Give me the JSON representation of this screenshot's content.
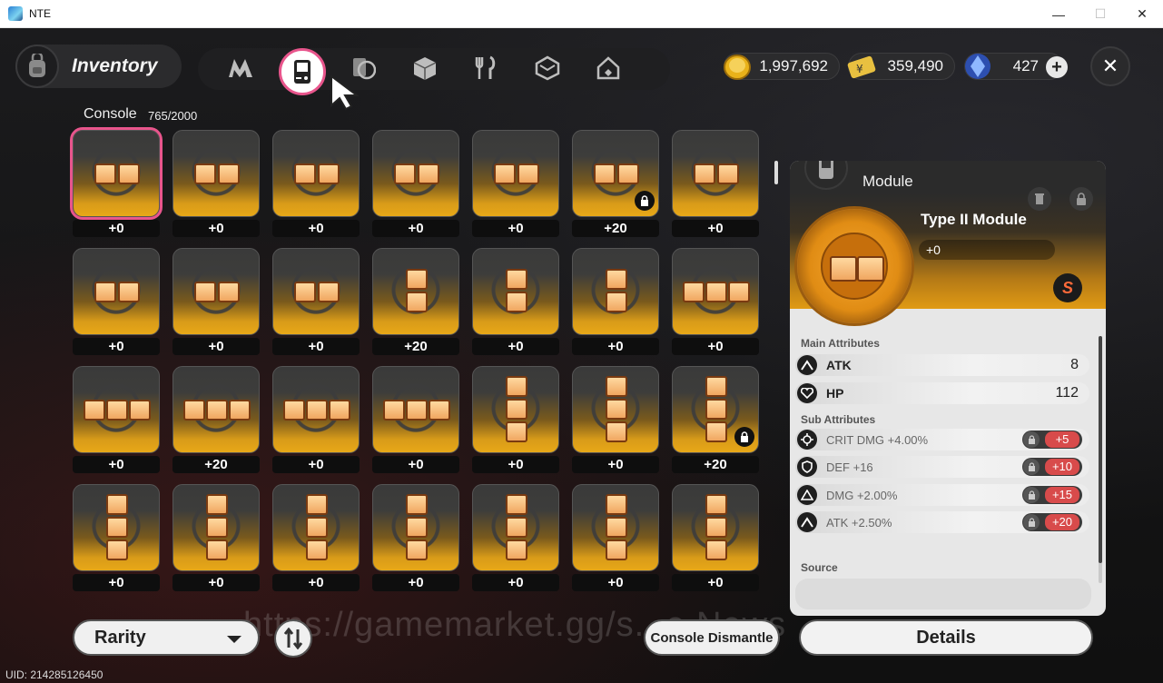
{
  "window": {
    "title": "NTE",
    "minimize": "—",
    "maximize": "☐",
    "close": "✕"
  },
  "header": {
    "title": "Inventory",
    "tabs": [
      "n-logo",
      "console",
      "cards",
      "box",
      "food",
      "cube",
      "home"
    ],
    "currencies": [
      {
        "icon": "gold-coin-icon",
        "value": "1,997,692"
      },
      {
        "icon": "ticket-icon",
        "value": "359,490"
      },
      {
        "icon": "crystal-icon",
        "value": "427"
      }
    ],
    "plus": "+",
    "close": "✕"
  },
  "category": {
    "label": "Console",
    "count": "765/2000"
  },
  "grid": [
    [
      {
        "level": "+0",
        "shape": "h2",
        "selected": true
      },
      {
        "level": "+0",
        "shape": "h2"
      },
      {
        "level": "+0",
        "shape": "h2"
      },
      {
        "level": "+0",
        "shape": "h2"
      },
      {
        "level": "+0",
        "shape": "h2"
      },
      {
        "level": "+20",
        "shape": "h2",
        "locked": true
      },
      {
        "level": "+0",
        "shape": "h2"
      }
    ],
    [
      {
        "level": "+0",
        "shape": "h2"
      },
      {
        "level": "+0",
        "shape": "h2"
      },
      {
        "level": "+0",
        "shape": "h2"
      },
      {
        "level": "+20",
        "shape": "v2"
      },
      {
        "level": "+0",
        "shape": "v2"
      },
      {
        "level": "+0",
        "shape": "v2"
      },
      {
        "level": "+0",
        "shape": "h3"
      }
    ],
    [
      {
        "level": "+0",
        "shape": "h3"
      },
      {
        "level": "+20",
        "shape": "h3"
      },
      {
        "level": "+0",
        "shape": "h3"
      },
      {
        "level": "+0",
        "shape": "h3"
      },
      {
        "level": "+0",
        "shape": "v3"
      },
      {
        "level": "+0",
        "shape": "v3"
      },
      {
        "level": "+20",
        "shape": "v3",
        "locked": true
      }
    ],
    [
      {
        "level": "+0",
        "shape": "v3"
      },
      {
        "level": "+0",
        "shape": "v3"
      },
      {
        "level": "+0",
        "shape": "v3"
      },
      {
        "level": "+0",
        "shape": "v3"
      },
      {
        "level": "+0",
        "shape": "v3"
      },
      {
        "level": "+0",
        "shape": "v3"
      },
      {
        "level": "+0",
        "shape": "v3"
      }
    ]
  ],
  "panel": {
    "section": "Module",
    "name": "Type II Module",
    "level": "+0",
    "main_attributes_label": "Main Attributes",
    "main": [
      {
        "name": "ATK",
        "value": "8",
        "icon": "atk-icon"
      },
      {
        "name": "HP",
        "value": "112",
        "icon": "hp-icon"
      }
    ],
    "sub_attributes_label": "Sub Attributes",
    "sub": [
      {
        "name": "CRIT DMG +4.00%",
        "upgrade": "+5",
        "icon": "crit-icon"
      },
      {
        "name": "DEF +16",
        "upgrade": "+10",
        "icon": "def-icon"
      },
      {
        "name": "DMG +2.00%",
        "upgrade": "+15",
        "icon": "dmg-icon"
      },
      {
        "name": "ATK +2.50%",
        "upgrade": "+20",
        "icon": "atk-icon"
      }
    ],
    "source_label": "Source"
  },
  "footer": {
    "rarity": "Rarity",
    "dismantle": "Console Dismantle",
    "details": "Details",
    "uid": "UID: 214285126450",
    "watermark": "https://gamemarket.gg/s...e News"
  },
  "colors": {
    "accent": "#e8558c",
    "gold": "#e8a818",
    "upgrade": "#d84b4b"
  }
}
